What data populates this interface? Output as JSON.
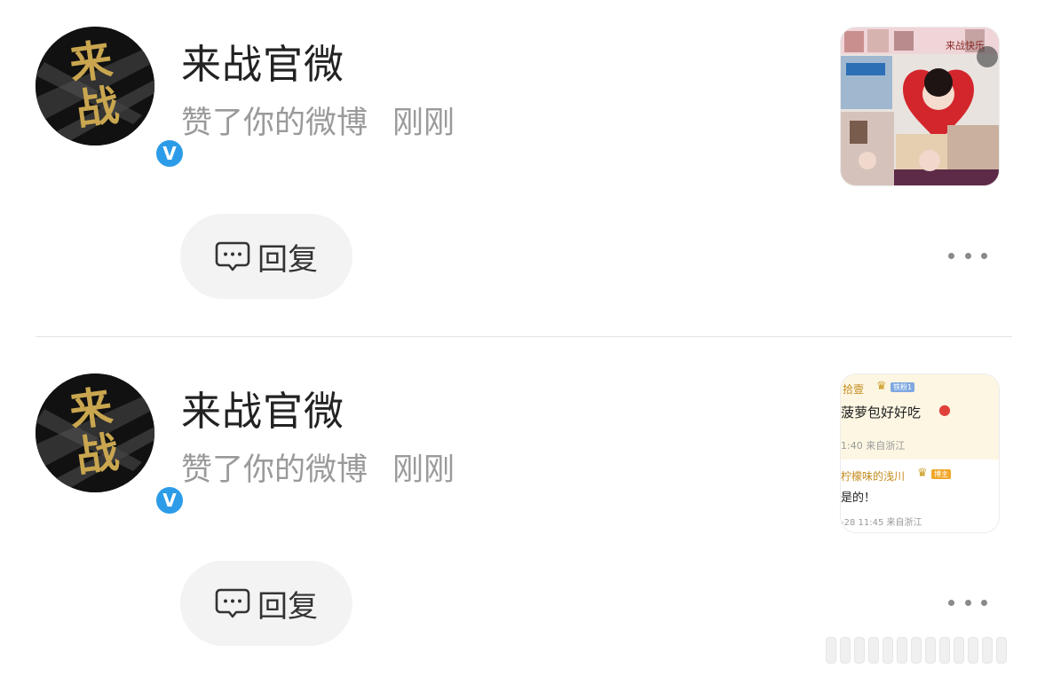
{
  "notifications": [
    {
      "user": {
        "name": "来战官微",
        "avatar_text": "来战",
        "verified_badge": "V"
      },
      "action": "赞了你的微博",
      "time": "刚刚",
      "thumbnail": {
        "kind": "photo-collage",
        "top_text": "来战快乐"
      },
      "reply_label": "回复"
    },
    {
      "user": {
        "name": "来战官微",
        "avatar_text": "来战",
        "verified_badge": "V"
      },
      "action": "赞了你的微博",
      "time": "刚刚",
      "thumbnail": {
        "kind": "comment-screenshot",
        "comment1_user": "拾壹",
        "comment1_badge": "铁粉1",
        "comment1_text": "菠萝包好好吃",
        "comment1_meta": "1:40 来自浙江",
        "comment2_user": "柠檬味的浅川",
        "comment2_badge": "博主",
        "comment2_text": "是的！",
        "comment2_meta": "-28 11:45 来自浙江"
      },
      "reply_label": "回复"
    }
  ],
  "colors": {
    "username": "#222222",
    "secondary_text": "#9a9a9a",
    "verified_blue": "#2d9ce8",
    "reply_bg": "#f3f3f3",
    "divider": "#e3e3e3"
  },
  "icons": {
    "reply": "comment-bubble-icon",
    "more": "more-horizontal-icon",
    "verified": "verified-v-icon"
  }
}
